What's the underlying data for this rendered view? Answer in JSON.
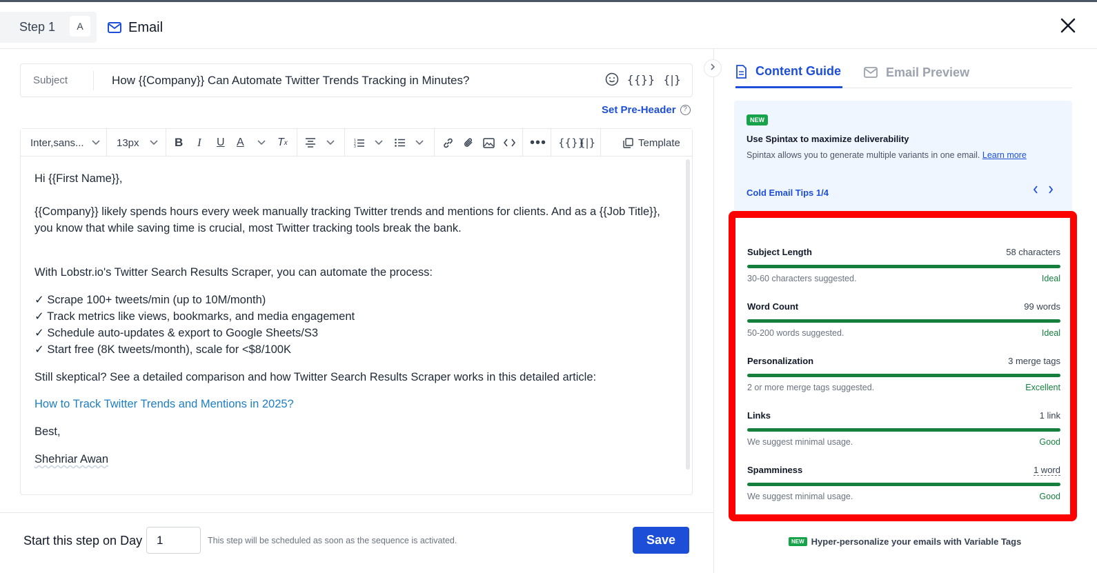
{
  "header": {
    "step_label": "Step 1",
    "variant": "A",
    "channel": "Email"
  },
  "subject": {
    "label": "Subject",
    "value": "How {{Company}} Can Automate Twitter Trends Tracking in Minutes?",
    "icons": [
      "emoji-icon",
      "merge-tag-icon",
      "spintax-icon"
    ]
  },
  "preheader_link": "Set Pre-Header",
  "toolbar": {
    "font": "Inter,sans...",
    "size": "13px",
    "template_label": "Template"
  },
  "body": {
    "greeting": "Hi {{First Name}},",
    "para1": "{{Company}} likely spends hours every week manually tracking Twitter trends and mentions for clients. And as a {{Job Title}}, you know that while saving time is crucial, most Twitter tracking tools break the bank.",
    "para2": "With Lobstr.io's Twitter Search Results Scraper, you can automate the process:",
    "bullets": [
      "✓ Scrape 100+ tweets/min (up to 10M/month)",
      "✓ Track metrics like views, bookmarks, and media engagement",
      "✓ Schedule auto-updates & export to Google Sheets/S3",
      "✓ Start free (8K tweets/month), scale for <$8/100K"
    ],
    "para3": "Still skeptical? See a detailed comparison and how Twitter Search Results Scraper works in this detailed article:",
    "link": "How to Track Twitter Trends and Mentions in 2025?",
    "closing": "Best,",
    "signature": "Shehriar Awan"
  },
  "footer": {
    "start_label": "Start this step on Day",
    "day_value": "1",
    "note": "This step will be scheduled as soon as the sequence is activated.",
    "save_label": "Save"
  },
  "panel": {
    "tabs": [
      "Content Guide",
      "Email Preview"
    ],
    "tip": {
      "badge": "NEW",
      "title": "Use Spintax to maximize deliverability",
      "desc": "Spintax allows you to generate multiple variants in one email.",
      "learn_more": "Learn more",
      "counter": "Cold Email Tips 1/4"
    },
    "metrics": [
      {
        "name": "Subject Length",
        "value": "58 characters",
        "hint": "30-60 characters suggested.",
        "rating": "Ideal",
        "fill": 1.0
      },
      {
        "name": "Word Count",
        "value": "99 words",
        "hint": "50-200 words suggested.",
        "rating": "Ideal",
        "fill": 1.0
      },
      {
        "name": "Personalization",
        "value": "3 merge tags",
        "hint": "2 or more merge tags suggested.",
        "rating": "Excellent",
        "fill": 1.0
      },
      {
        "name": "Links",
        "value": "1 link",
        "hint": "We suggest minimal usage.",
        "rating": "Good",
        "fill": 1.0
      },
      {
        "name": "Spamminess",
        "value": "1 word",
        "hint": "We suggest minimal usage.",
        "rating": "Good",
        "fill": 1.0
      }
    ],
    "promo": {
      "badge": "NEW",
      "text": "Hyper-personalize your emails with Variable Tags"
    }
  },
  "colors": {
    "accent": "#1d4ed8",
    "success": "#15803d",
    "highlight": "#ff0000"
  }
}
